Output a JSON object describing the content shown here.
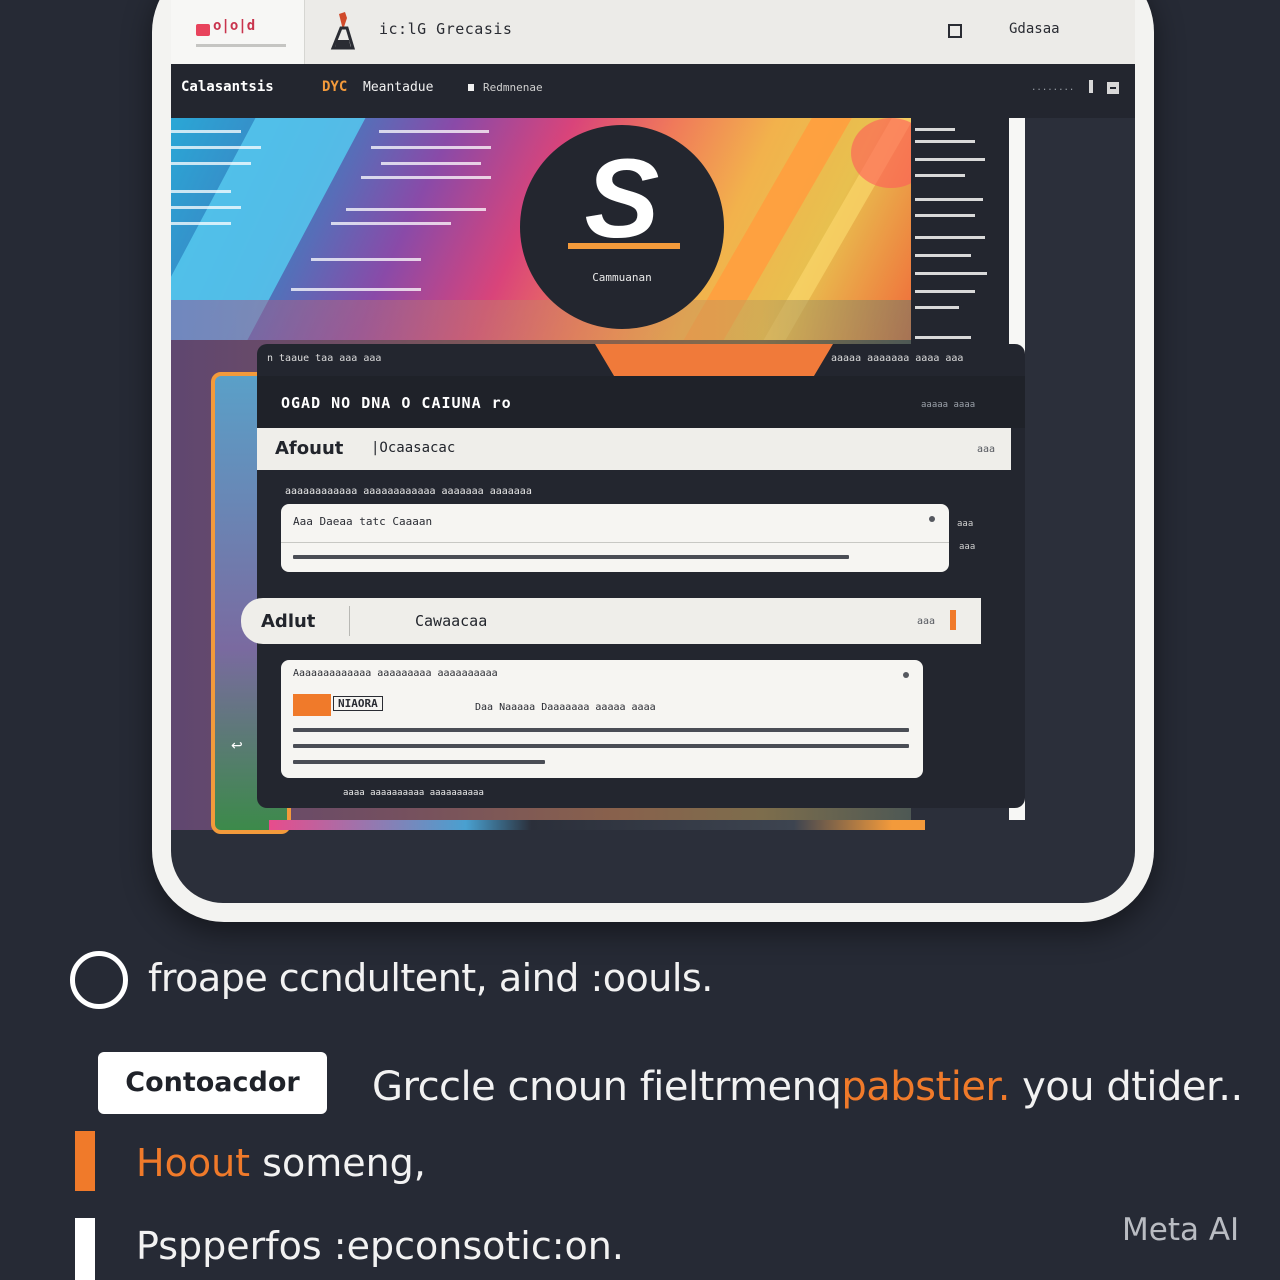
{
  "topbar": {
    "tab_label": "o|o|d",
    "app_title": "ic:lG Grecasis",
    "right_label": "Gdasaa"
  },
  "navbar": {
    "title": "Calasantsis",
    "orange_label": "DYC",
    "breadcrumb": "Meantadue",
    "breadcrumb_sub": "Redmnenae"
  },
  "logo": {
    "letter": "S",
    "caption": "Cammuanan"
  },
  "panel": {
    "top_left": "n taaue taa aaa aaa",
    "top_right": "aaaaa aaaaaaa aaaa aaa",
    "title": "OGAD NO DNA O CAIUNA  ro",
    "meta": "aaaaa  aaaa"
  },
  "tab1": {
    "label": "Afouut",
    "label2": "|Ocaasacac",
    "right": "aaa"
  },
  "section1": {
    "label": "aaaaaaaaaaaa aaaaaaaaaaaa aaaaaaa aaaaaaa"
  },
  "card1": {
    "title": "Aaa Daeaa tatc Caaaan",
    "side_a": "aaa",
    "side_b": "aaa"
  },
  "tab2": {
    "label": "Adlut",
    "label2": "Cawaacaa",
    "right": "aaa"
  },
  "card2": {
    "title": "Aaaaaaaaaaaaa aaaaaaaaa aaaaaaaaaa",
    "tag": "NIAORA",
    "mid_text": "Daa Naaaaa Daaaaaaa aaaaa aaaa"
  },
  "panel_footer": "aaaa aaaaaaaaaa aaaaaaaaaa",
  "features": {
    "line1": "froape ccndultent, aind :oouls.",
    "cta_label": "Contoacdor",
    "cta_desc_a": "Grccle cnoun fieltrmenq",
    "cta_desc_b": "pabstier.",
    "cta_desc_c": " you dtider..",
    "line2_a": "Hoout",
    "line2_b": " someng,",
    "line3": "Pspperfos :epconsotic:on."
  },
  "watermark": "Meta AI",
  "colors": {
    "background": "#262a35",
    "accent": "#f07a2a",
    "panel": "#23262f",
    "card": "#f6f5f2"
  },
  "icons": [
    "app-torch-icon",
    "window-square-icon",
    "minimize-icon",
    "logo-s-icon",
    "ring-icon"
  ]
}
